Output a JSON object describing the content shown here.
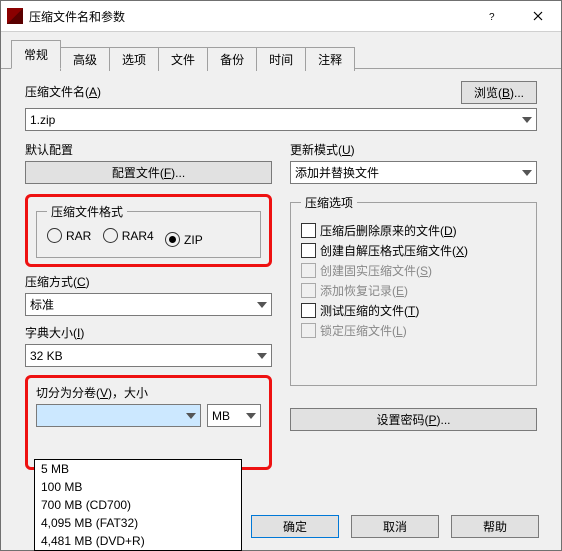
{
  "title": "压缩文件名和参数",
  "tabs": [
    "常规",
    "高级",
    "选项",
    "文件",
    "备份",
    "时间",
    "注释"
  ],
  "archive_name": {
    "label_pre": "压缩文件名(",
    "key": "A",
    "label_post": ")",
    "value": "1.zip"
  },
  "browse": {
    "pre": "浏览(",
    "key": "B",
    "post": ")..."
  },
  "default_profile": {
    "label": "默认配置",
    "btn_pre": "配置文件(",
    "key": "F",
    "btn_post": ")..."
  },
  "update_mode": {
    "label_pre": "更新模式(",
    "key": "U",
    "label_post": ")",
    "value": "添加并替换文件"
  },
  "format": {
    "legend": "压缩文件格式",
    "options": [
      "RAR",
      "RAR4",
      "ZIP"
    ],
    "selected": 2
  },
  "method": {
    "label_pre": "压缩方式(",
    "key": "C",
    "label_post": ")",
    "value": "标准"
  },
  "dict": {
    "label_pre": "字典大小(",
    "key": "I",
    "label_post": ")",
    "value": "32 KB"
  },
  "split": {
    "label_pre": "切分为分卷(",
    "key": "V",
    "label_post": ")，大小",
    "unit": "MB",
    "options": [
      "5 MB",
      "100 MB",
      "700 MB  (CD700)",
      "4,095 MB  (FAT32)",
      "4,481 MB  (DVD+R)"
    ]
  },
  "options": {
    "legend": "压缩选项",
    "items": [
      {
        "pre": "压缩后删除原来的文件(",
        "key": "D",
        "post": ")",
        "disabled": false
      },
      {
        "pre": "创建自解压格式压缩文件(",
        "key": "X",
        "post": ")",
        "disabled": false
      },
      {
        "pre": "创建固实压缩文件(",
        "key": "S",
        "post": ")",
        "disabled": true
      },
      {
        "pre": "添加恢复记录(",
        "key": "E",
        "post": ")",
        "disabled": true
      },
      {
        "pre": "测试压缩的文件(",
        "key": "T",
        "post": ")",
        "disabled": false
      },
      {
        "pre": "锁定压缩文件(",
        "key": "L",
        "post": ")",
        "disabled": true
      }
    ]
  },
  "set_password": {
    "pre": "设置密码(",
    "key": "P",
    "post": ")..."
  },
  "footer": {
    "ok": "确定",
    "cancel": "取消",
    "help": "帮助"
  }
}
